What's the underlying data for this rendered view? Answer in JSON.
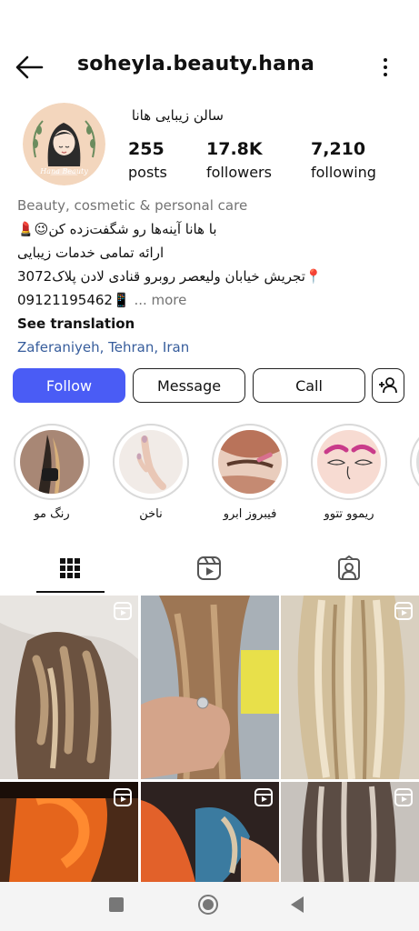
{
  "header": {
    "username": "soheyla.beauty.hana"
  },
  "profile": {
    "display_name": "سالن زیبایی هانا",
    "avatar_text": "Hana Beauty",
    "stats": [
      {
        "value": "255",
        "label": "posts"
      },
      {
        "value": "17.8K",
        "label": "followers"
      },
      {
        "value": "7,210",
        "label": "following"
      }
    ]
  },
  "bio": {
    "category": "Beauty, cosmetic & personal care",
    "line1": "با هانا آینه‌ها رو شگفت‌زده کن😉💄",
    "line2": "ارائه تمامی خدمات زیبایی",
    "line3": "📍تجریش خیابان ولیعصر روبرو قنادی لادن پلاک3072",
    "phone": "09121195462📱",
    "more": "... more",
    "see_translation": "See translation",
    "location": "Zaferaniyeh, Tehran, Iran"
  },
  "actions": {
    "follow": "Follow",
    "message": "Message",
    "call": "Call"
  },
  "highlights": [
    {
      "label": "رنگ مو"
    },
    {
      "label": "ناخن"
    },
    {
      "label": "فیبروز ابرو"
    },
    {
      "label": "ریموو تتوو"
    }
  ],
  "colors": {
    "accent": "#4a5cf5",
    "link": "#375d9c",
    "muted": "#737373"
  }
}
